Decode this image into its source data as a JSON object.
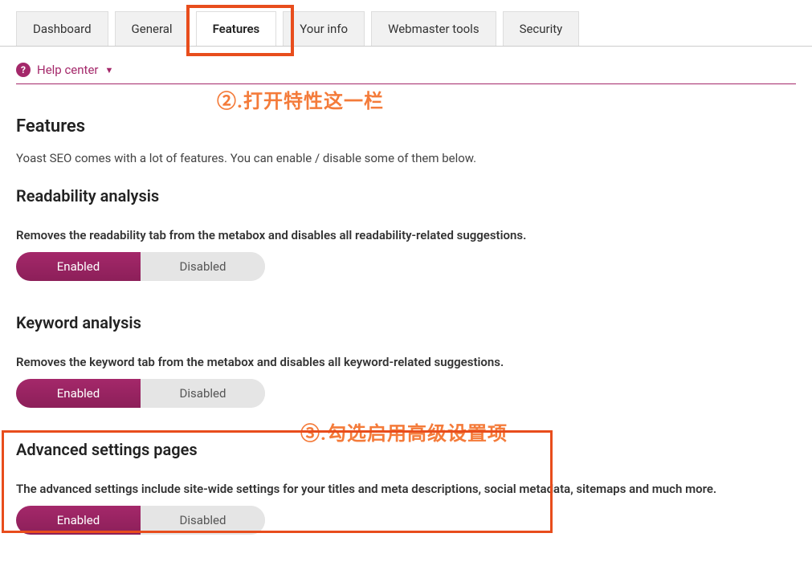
{
  "tabs": {
    "items": [
      {
        "label": "Dashboard",
        "active": false
      },
      {
        "label": "General",
        "active": false
      },
      {
        "label": "Features",
        "active": true
      },
      {
        "label": "Your info",
        "active": false
      },
      {
        "label": "Webmaster tools",
        "active": false
      },
      {
        "label": "Security",
        "active": false
      }
    ]
  },
  "helpCenter": {
    "label": "Help center"
  },
  "annotations": {
    "step2": "②.打开特性这一栏",
    "step3": "③.勾选启用高级设置项"
  },
  "page": {
    "title": "Features",
    "intro": "Yoast SEO comes with a lot of features. You can enable / disable some of them below."
  },
  "sections": {
    "readability": {
      "title": "Readability analysis",
      "desc": "Removes the readability tab from the metabox and disables all readability-related suggestions.",
      "enabled": "Enabled",
      "disabled": "Disabled"
    },
    "keyword": {
      "title": "Keyword analysis",
      "desc": "Removes the keyword tab from the metabox and disables all keyword-related suggestions.",
      "enabled": "Enabled",
      "disabled": "Disabled"
    },
    "advanced": {
      "title": "Advanced settings pages",
      "desc": "The advanced settings include site-wide settings for your titles and meta descriptions, social metadata, sitemaps and much more.",
      "enabled": "Enabled",
      "disabled": "Disabled"
    }
  }
}
